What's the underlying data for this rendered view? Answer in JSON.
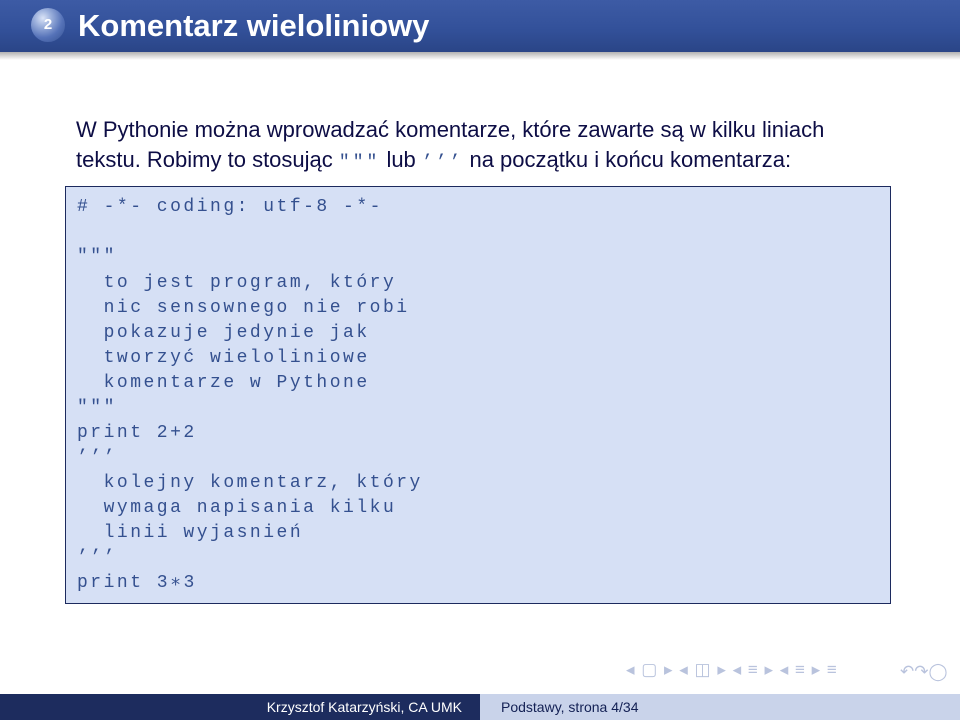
{
  "slide": {
    "number": "2",
    "title": "Komentarz wieloliniowy",
    "intro": {
      "line1": "W Pythonie można wprowadzać komentarze, które zawarte są w kilku liniach",
      "line2_part1": "tekstu. Robimy to stosując",
      "triple_double": "\"\"\"",
      "line2_part2": "lub",
      "triple_single": "’’’",
      "line2_part3": "na początku i końcu komentarza:"
    },
    "code_lines": [
      "# -*- coding: utf-8 -*-",
      "",
      "\"\"\"",
      "  to jest program, który",
      "  nic sensownego nie robi",
      "  pokazuje jedynie jak",
      "  tworzyć wieloliniowe",
      "  komentarze w Pythone",
      "\"\"\"",
      "print 2+2",
      "’’’",
      "  kolejny komentarz, który",
      "  wymaga napisania kilku",
      "  linii wyjasnień",
      "’’’",
      "print 3∗3"
    ]
  },
  "footer": {
    "author": "Krzysztof Katarzyński, CA UMK",
    "course_page": "Podstawy, strona 4/34"
  },
  "nav_symbols": {
    "arrows": "◂ ▢ ▸ ◂ ◫ ▸ ◂ ≡ ▸ ◂ ≡ ▸ ≡",
    "search": "↶↷◯"
  }
}
